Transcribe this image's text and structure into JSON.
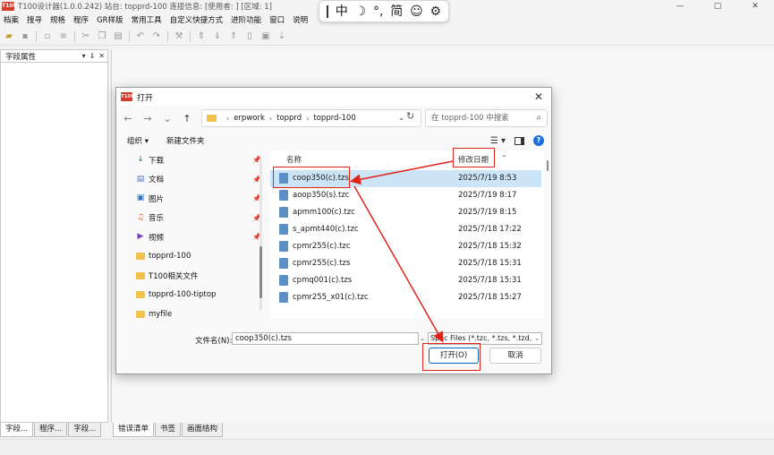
{
  "app": {
    "logo": "T100",
    "title": "T100设计器(1.0.0.242) 站台: topprd-100 连接信息: [使用者:              ]          [区域: 1]",
    "window_controls": [
      "—",
      "▢",
      "✕"
    ]
  },
  "ime": {
    "items": [
      "中",
      "☽",
      "°,",
      "简",
      "☺",
      "⚙"
    ]
  },
  "menubar": [
    "档案",
    "搜寻",
    "规格",
    "程序",
    "GR样版",
    "常用工具",
    "自定义快捷方式",
    "进阶功能",
    "窗口",
    "说明"
  ],
  "left_panel": {
    "title": "字段属性",
    "controls": [
      "▾",
      "⇓",
      "✕"
    ]
  },
  "bottom_tabs_left": [
    "字段...",
    "程序...",
    "字段..."
  ],
  "bottom_tabs_right": [
    "错误清单",
    "书签",
    "画面结构"
  ],
  "dialog": {
    "logo": "T100",
    "title": "打开",
    "close": "✕",
    "nav": {
      "back": "←",
      "forward": "→",
      "dropdown": "⌄",
      "up": "↑",
      "breadcrumbs": [
        "erpwork",
        "topprd",
        "topprd-100"
      ],
      "refresh": "↻",
      "search_placeholder": "在 topprd-100 中搜索",
      "search_icon": "⌕"
    },
    "commands": {
      "organize": "组织 ▾",
      "new_folder": "新建文件夹",
      "view": "☰ ▾"
    },
    "nav_pane": [
      {
        "icon": "download-icon",
        "glyph": "↓",
        "label": "下载",
        "pinned": true,
        "color": "#2a7a3a"
      },
      {
        "icon": "document-icon",
        "glyph": "▤",
        "label": "文档",
        "pinned": true,
        "color": "#4a76b8"
      },
      {
        "icon": "picture-icon",
        "glyph": "▣",
        "label": "图片",
        "pinned": true,
        "color": "#2a74c8"
      },
      {
        "icon": "music-icon",
        "glyph": "♫",
        "label": "音乐",
        "pinned": true,
        "color": "#e0562a"
      },
      {
        "icon": "video-icon",
        "glyph": "▶",
        "label": "视频",
        "pinned": true,
        "color": "#7a3ec8"
      },
      {
        "icon": "folder-icon",
        "label": "topprd-100",
        "pinned": false
      },
      {
        "icon": "folder-icon",
        "label": "T100相关文件",
        "pinned": false
      },
      {
        "icon": "folder-icon",
        "label": "topprd-100-tiptop",
        "pinned": false
      },
      {
        "icon": "folder-icon",
        "label": "myfile",
        "pinned": false
      }
    ],
    "pin_glyph": "📌",
    "file_columns": {
      "name": "名称",
      "date": "修改日期",
      "sort": "⌄"
    },
    "files": [
      {
        "name": "coop350(c).tzs",
        "date": "2025/7/19 8:53",
        "selected": true
      },
      {
        "name": "aoop350(s).tzc",
        "date": "2025/7/19 8:17"
      },
      {
        "name": "apmm100(c).tzc",
        "date": "2025/7/19 8:15"
      },
      {
        "name": "s_apmt440(c).tzc",
        "date": "2025/7/18 17:22"
      },
      {
        "name": "cpmr255(c).tzc",
        "date": "2025/7/18 15:32"
      },
      {
        "name": "cpmr255(c).tzs",
        "date": "2025/7/18 15:31"
      },
      {
        "name": "cpmq001(c).tzs",
        "date": "2025/7/18 15:31"
      },
      {
        "name": "cpmr255_x01(c).tzc",
        "date": "2025/7/18 15:27"
      }
    ],
    "filename_label": "文件名(N):",
    "filename_value": "coop350(c).tzs",
    "filetype_value": "Spec Files (*.tzc, *.tzs, *.tzd, *.",
    "open_label": "打开(O)",
    "cancel_label": "取消"
  },
  "colors": {
    "annotation": "#e2231a",
    "selection": "#cce4f7",
    "accent": "#0067c0"
  }
}
